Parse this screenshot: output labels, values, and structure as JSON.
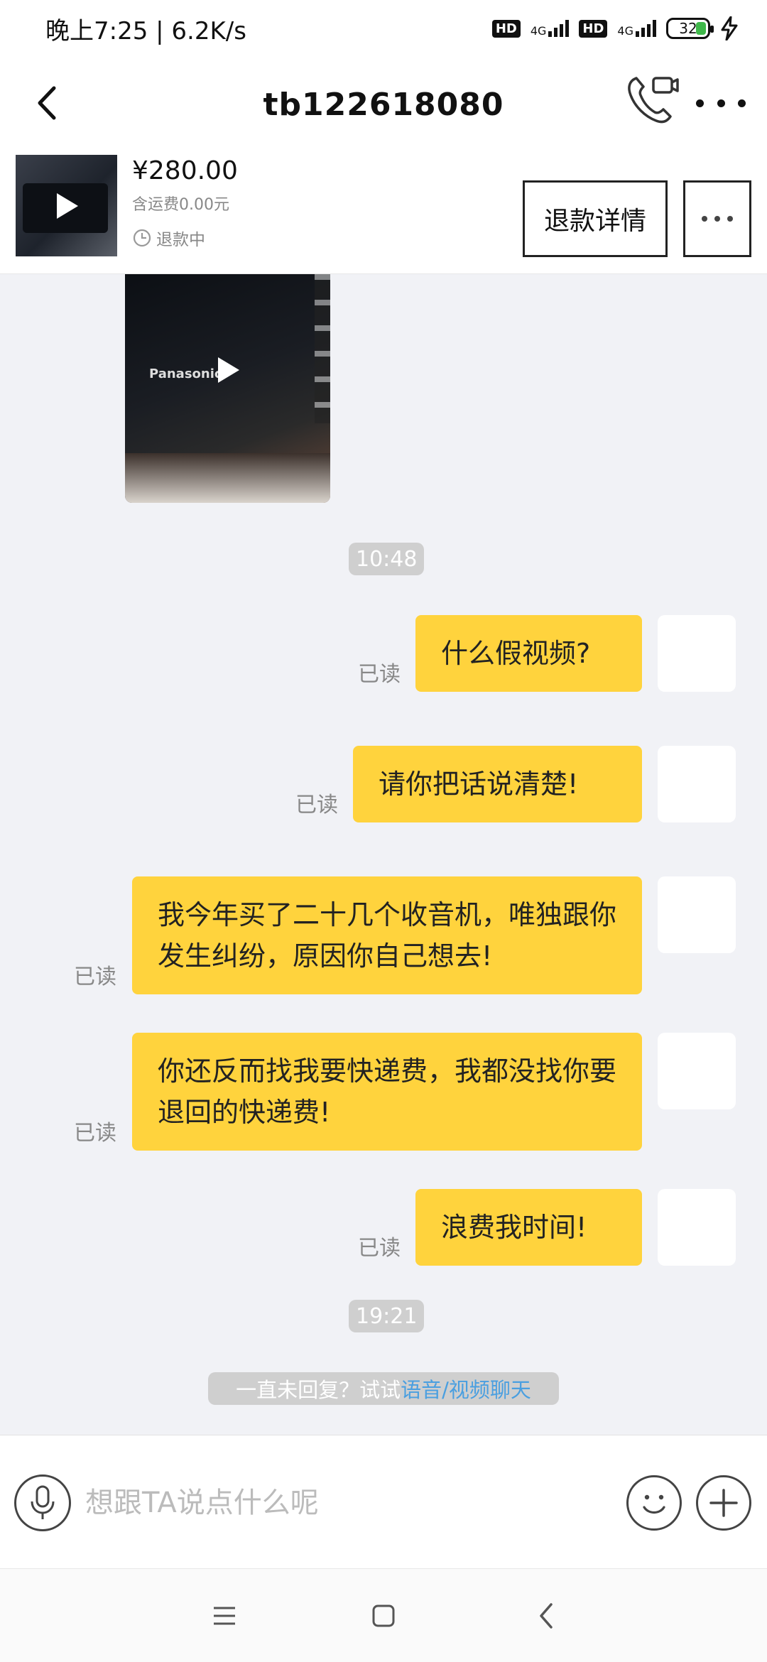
{
  "status_bar": {
    "time_speed": "晚上7:25 | 6.2K/s",
    "hd1": "HD",
    "net1": "4G",
    "hd2": "HD",
    "net2": "4G",
    "battery": "32"
  },
  "header": {
    "title": "tb122618080"
  },
  "product": {
    "price": "¥280.00",
    "shipping": "含运费0.00元",
    "status": "退款中",
    "refund_button": "退款详情"
  },
  "messages": {
    "time1": "10:48",
    "m1": "什么假视频?",
    "m2": "请你把话说清楚!",
    "m3": "我今年买了二十几个收音机，唯独跟你发生纠纷，原因你自己想去!",
    "m4": "你还反而找我要快递费，我都没找你要退回的快递费!",
    "m5": "浪费我时间!",
    "read": "已读",
    "time2": "19:21",
    "hint_prefix": "一直未回复？试试",
    "hint_link": "语音/视频聊天"
  },
  "input": {
    "placeholder": "想跟TA说点什么呢"
  },
  "video": {
    "brand": "Panasonic"
  }
}
